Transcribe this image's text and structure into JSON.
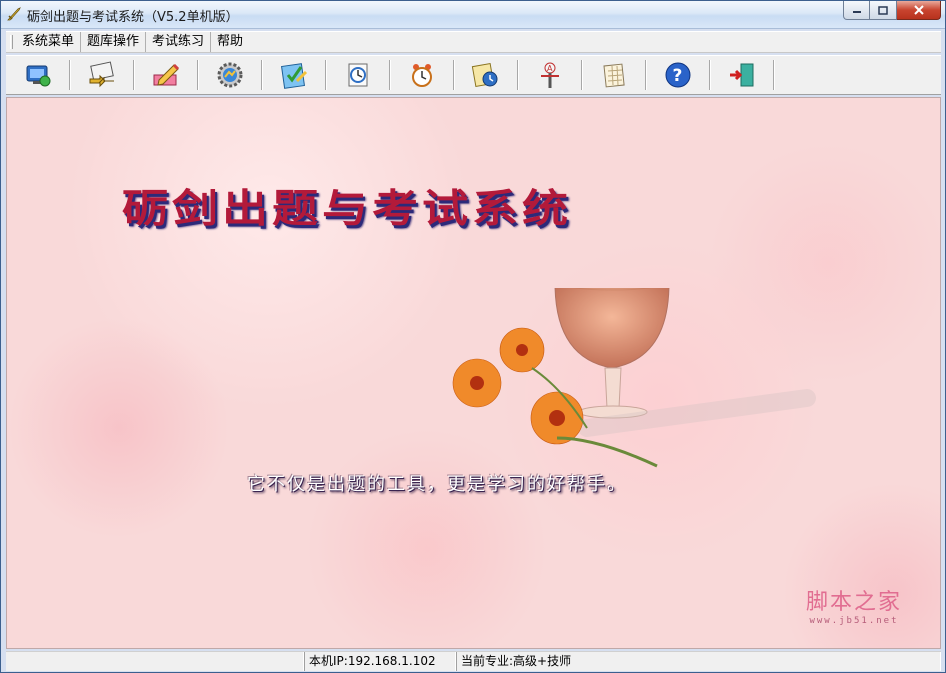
{
  "window": {
    "title": "砺剑出题与考试系统（V5.2单机版）",
    "title_bar_color": "#dbe8f7",
    "close_button_color": "#c8442f"
  },
  "menubar": {
    "items": [
      {
        "label": "系统菜单"
      },
      {
        "label": "题库操作"
      },
      {
        "label": "考试练习"
      },
      {
        "label": "帮助"
      }
    ]
  },
  "toolbar": {
    "buttons": [
      {
        "icon": "monitor-settings-icon"
      },
      {
        "icon": "import-export-icon"
      },
      {
        "icon": "edit-pencil-icon"
      },
      {
        "icon": "gear-picture-icon"
      },
      {
        "icon": "test-paper-icon"
      },
      {
        "icon": "clock-document-icon"
      },
      {
        "icon": "alarm-clock-icon"
      },
      {
        "icon": "exam-record-icon"
      },
      {
        "icon": "tools-icon"
      },
      {
        "icon": "grid-table-icon"
      },
      {
        "icon": "help-icon"
      },
      {
        "icon": "exit-door-icon"
      }
    ]
  },
  "splash": {
    "title": "砺剑出题与考试系统",
    "slogan": "它不仅是出题的工具，更是学习的好帮手。",
    "background_color": "#f9d9d9",
    "title_color": "#b31a3a",
    "title_shadow_color": "#2c2a7a"
  },
  "watermark": {
    "text": "脚本之家",
    "url": "www.jb51.net",
    "color": "#e16d91"
  },
  "statusbar": {
    "ip": "本机IP:192.168.1.102",
    "major": "当前专业:高级+技师"
  }
}
